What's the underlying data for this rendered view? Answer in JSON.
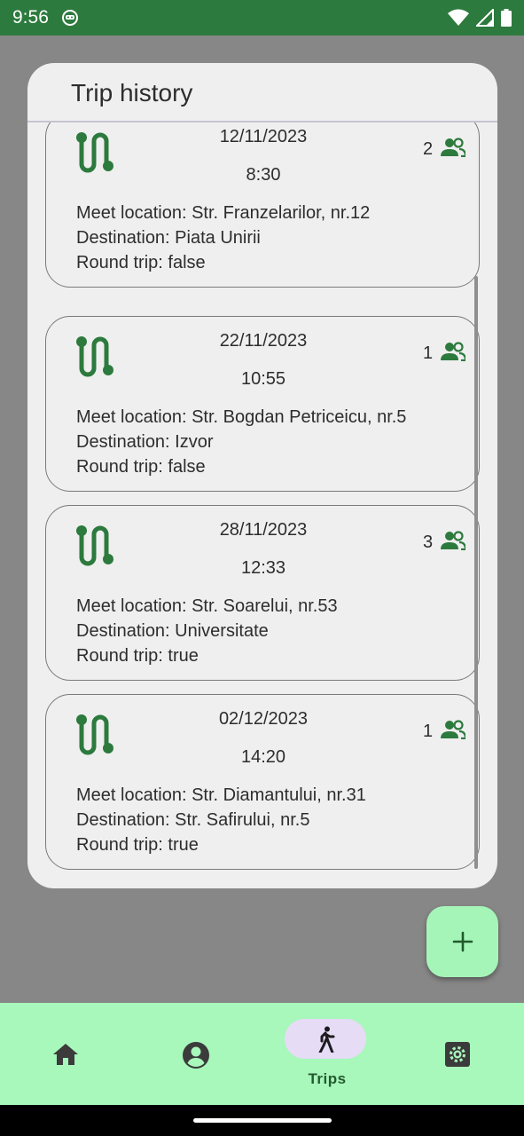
{
  "status_bar": {
    "time": "9:56",
    "icons": [
      "app-notification-icon",
      "wifi-icon",
      "signal-icon",
      "battery-icon"
    ]
  },
  "dialog": {
    "title": "Trip history"
  },
  "trips": [
    {
      "date": "12/11/2023",
      "time": "8:30",
      "passengers": "2",
      "meet": "Meet location: Str. Franzelarilor, nr.12",
      "destination": "Destination: Piata Unirii",
      "round_trip": "Round trip: false"
    },
    {
      "date": "22/11/2023",
      "time": "10:55",
      "passengers": "1",
      "meet": "Meet location: Str. Bogdan Petriceicu, nr.5",
      "destination": "Destination: Izvor",
      "round_trip": "Round trip: false"
    },
    {
      "date": "28/11/2023",
      "time": "12:33",
      "passengers": "3",
      "meet": "Meet location: Str. Soarelui, nr.53",
      "destination": "Destination: Universitate",
      "round_trip": "Round trip: true"
    },
    {
      "date": "02/12/2023",
      "time": "14:20",
      "passengers": "1",
      "meet": "Meet location: Str. Diamantului, nr.31",
      "destination": "Destination: Str. Safirului, nr.5",
      "round_trip": "Round trip: true"
    }
  ],
  "fab": {
    "icon": "plus-icon"
  },
  "bottom_nav": {
    "items": [
      {
        "icon": "home-icon",
        "label": ""
      },
      {
        "icon": "account-icon",
        "label": ""
      },
      {
        "icon": "walk-icon",
        "label": "Trips",
        "selected": true
      },
      {
        "icon": "settings-icon",
        "label": ""
      }
    ]
  },
  "colors": {
    "status_bar": "#2c7a3d",
    "accent_green": "#2c7a3d",
    "nav_background": "#a8f7bb",
    "fab_background": "#a6f5b8",
    "nav_selected_pill": "#e6dcf6",
    "scrim": "#878787",
    "dialog_background": "#efefef"
  }
}
